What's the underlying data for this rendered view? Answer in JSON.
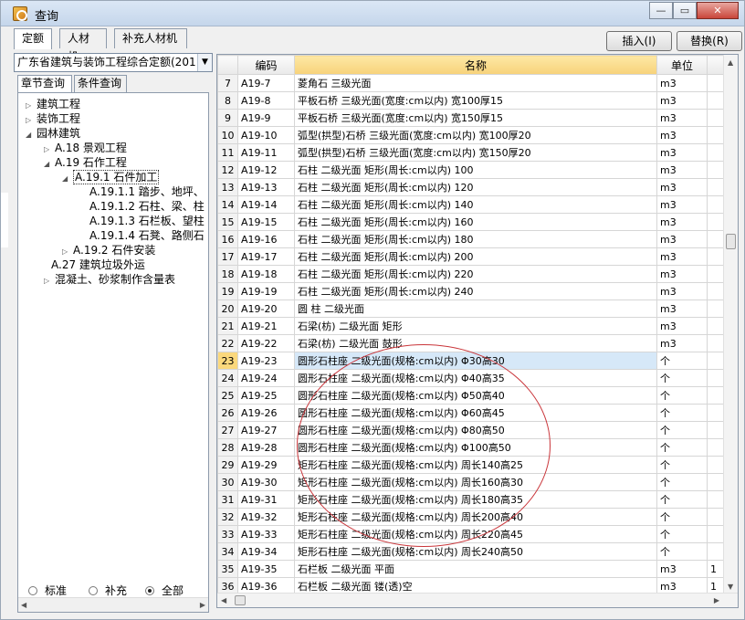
{
  "window": {
    "title": "查询",
    "min": "▭",
    "max": "▣",
    "close": "✕"
  },
  "tabs": [
    "定额",
    "人材机",
    "补充人材机"
  ],
  "buttons": {
    "insert": "插入(I)",
    "replace": "替换(R)"
  },
  "left": {
    "combo": "广东省建筑与装饰工程综合定额(201",
    "subtabs": [
      "章节查询",
      "条件查询"
    ],
    "tree": [
      "建筑工程",
      "装饰工程",
      "园林建筑",
      "A.18 景观工程",
      "A.19 石作工程",
      "A.19.1 石件加工",
      "A.19.1.1 踏步、地坪、",
      "A.19.1.2 石柱、梁、柱",
      "A.19.1.3 石栏板、望柱",
      "A.19.1.4 石凳、路侧石",
      "A.19.2 石件安装",
      "A.27 建筑垃圾外运",
      "混凝土、砂浆制作含量表"
    ],
    "radios": [
      "标准",
      "补充",
      "全部"
    ]
  },
  "grid": {
    "headers": [
      "编码",
      "名称",
      "单位"
    ],
    "rows": [
      {
        "n": "7",
        "code": "A19-7",
        "name": "菱角石 三级光面",
        "unit": "m3",
        "extra": ""
      },
      {
        "n": "8",
        "code": "A19-8",
        "name": "平板石桥 三级光面(宽度:cm以内) 宽100厚15",
        "unit": "m3",
        "extra": ""
      },
      {
        "n": "9",
        "code": "A19-9",
        "name": "平板石桥 三级光面(宽度:cm以内) 宽150厚15",
        "unit": "m3",
        "extra": ""
      },
      {
        "n": "10",
        "code": "A19-10",
        "name": "弧型(拱型)石桥 三级光面(宽度:cm以内) 宽100厚20",
        "unit": "m3",
        "extra": ""
      },
      {
        "n": "11",
        "code": "A19-11",
        "name": "弧型(拱型)石桥 三级光面(宽度:cm以内) 宽150厚20",
        "unit": "m3",
        "extra": ""
      },
      {
        "n": "12",
        "code": "A19-12",
        "name": "石柱 二级光面 矩形(周长:cm以内) 100",
        "unit": "m3",
        "extra": ""
      },
      {
        "n": "13",
        "code": "A19-13",
        "name": "石柱 二级光面 矩形(周长:cm以内) 120",
        "unit": "m3",
        "extra": ""
      },
      {
        "n": "14",
        "code": "A19-14",
        "name": "石柱 二级光面 矩形(周长:cm以内) 140",
        "unit": "m3",
        "extra": ""
      },
      {
        "n": "15",
        "code": "A19-15",
        "name": "石柱 二级光面 矩形(周长:cm以内) 160",
        "unit": "m3",
        "extra": ""
      },
      {
        "n": "16",
        "code": "A19-16",
        "name": "石柱 二级光面 矩形(周长:cm以内) 180",
        "unit": "m3",
        "extra": ""
      },
      {
        "n": "17",
        "code": "A19-17",
        "name": "石柱 二级光面 矩形(周长:cm以内) 200",
        "unit": "m3",
        "extra": ""
      },
      {
        "n": "18",
        "code": "A19-18",
        "name": "石柱 二级光面 矩形(周长:cm以内) 220",
        "unit": "m3",
        "extra": ""
      },
      {
        "n": "19",
        "code": "A19-19",
        "name": "石柱 二级光面 矩形(周长:cm以内) 240",
        "unit": "m3",
        "extra": ""
      },
      {
        "n": "20",
        "code": "A19-20",
        "name": "圆 柱 二级光面",
        "unit": "m3",
        "extra": ""
      },
      {
        "n": "21",
        "code": "A19-21",
        "name": "石梁(枋) 二级光面 矩形",
        "unit": "m3",
        "extra": ""
      },
      {
        "n": "22",
        "code": "A19-22",
        "name": "石梁(枋) 二级光面 鼓形",
        "unit": "m3",
        "extra": ""
      },
      {
        "n": "23",
        "code": "A19-23",
        "name": "圆形石柱座 二级光面(规格:cm以内) Φ30高30",
        "unit": "个",
        "extra": ""
      },
      {
        "n": "24",
        "code": "A19-24",
        "name": "圆形石柱座 二级光面(规格:cm以内) Φ40高35",
        "unit": "个",
        "extra": ""
      },
      {
        "n": "25",
        "code": "A19-25",
        "name": "圆形石柱座 二级光面(规格:cm以内) Φ50高40",
        "unit": "个",
        "extra": ""
      },
      {
        "n": "26",
        "code": "A19-26",
        "name": "圆形石柱座 二级光面(规格:cm以内) Φ60高45",
        "unit": "个",
        "extra": ""
      },
      {
        "n": "27",
        "code": "A19-27",
        "name": "圆形石柱座 二级光面(规格:cm以内) Φ80高50",
        "unit": "个",
        "extra": ""
      },
      {
        "n": "28",
        "code": "A19-28",
        "name": "圆形石柱座 二级光面(规格:cm以内) Φ100高50",
        "unit": "个",
        "extra": ""
      },
      {
        "n": "29",
        "code": "A19-29",
        "name": "矩形石柱座 二级光面(规格:cm以内) 周长140高25",
        "unit": "个",
        "extra": ""
      },
      {
        "n": "30",
        "code": "A19-30",
        "name": "矩形石柱座 二级光面(规格:cm以内) 周长160高30",
        "unit": "个",
        "extra": ""
      },
      {
        "n": "31",
        "code": "A19-31",
        "name": "矩形石柱座 二级光面(规格:cm以内) 周长180高35",
        "unit": "个",
        "extra": ""
      },
      {
        "n": "32",
        "code": "A19-32",
        "name": "矩形石柱座 二级光面(规格:cm以内) 周长200高40",
        "unit": "个",
        "extra": ""
      },
      {
        "n": "33",
        "code": "A19-33",
        "name": "矩形石柱座 二级光面(规格:cm以内) 周长220高45",
        "unit": "个",
        "extra": ""
      },
      {
        "n": "34",
        "code": "A19-34",
        "name": "矩形石柱座 二级光面(规格:cm以内) 周长240高50",
        "unit": "个",
        "extra": ""
      },
      {
        "n": "35",
        "code": "A19-35",
        "name": "石栏板 二级光面 平面",
        "unit": "m3",
        "extra": "1"
      },
      {
        "n": "36",
        "code": "A19-36",
        "name": "石栏板 二级光面 镂(透)空",
        "unit": "m3",
        "extra": "1"
      }
    ],
    "selected_row": "23"
  }
}
